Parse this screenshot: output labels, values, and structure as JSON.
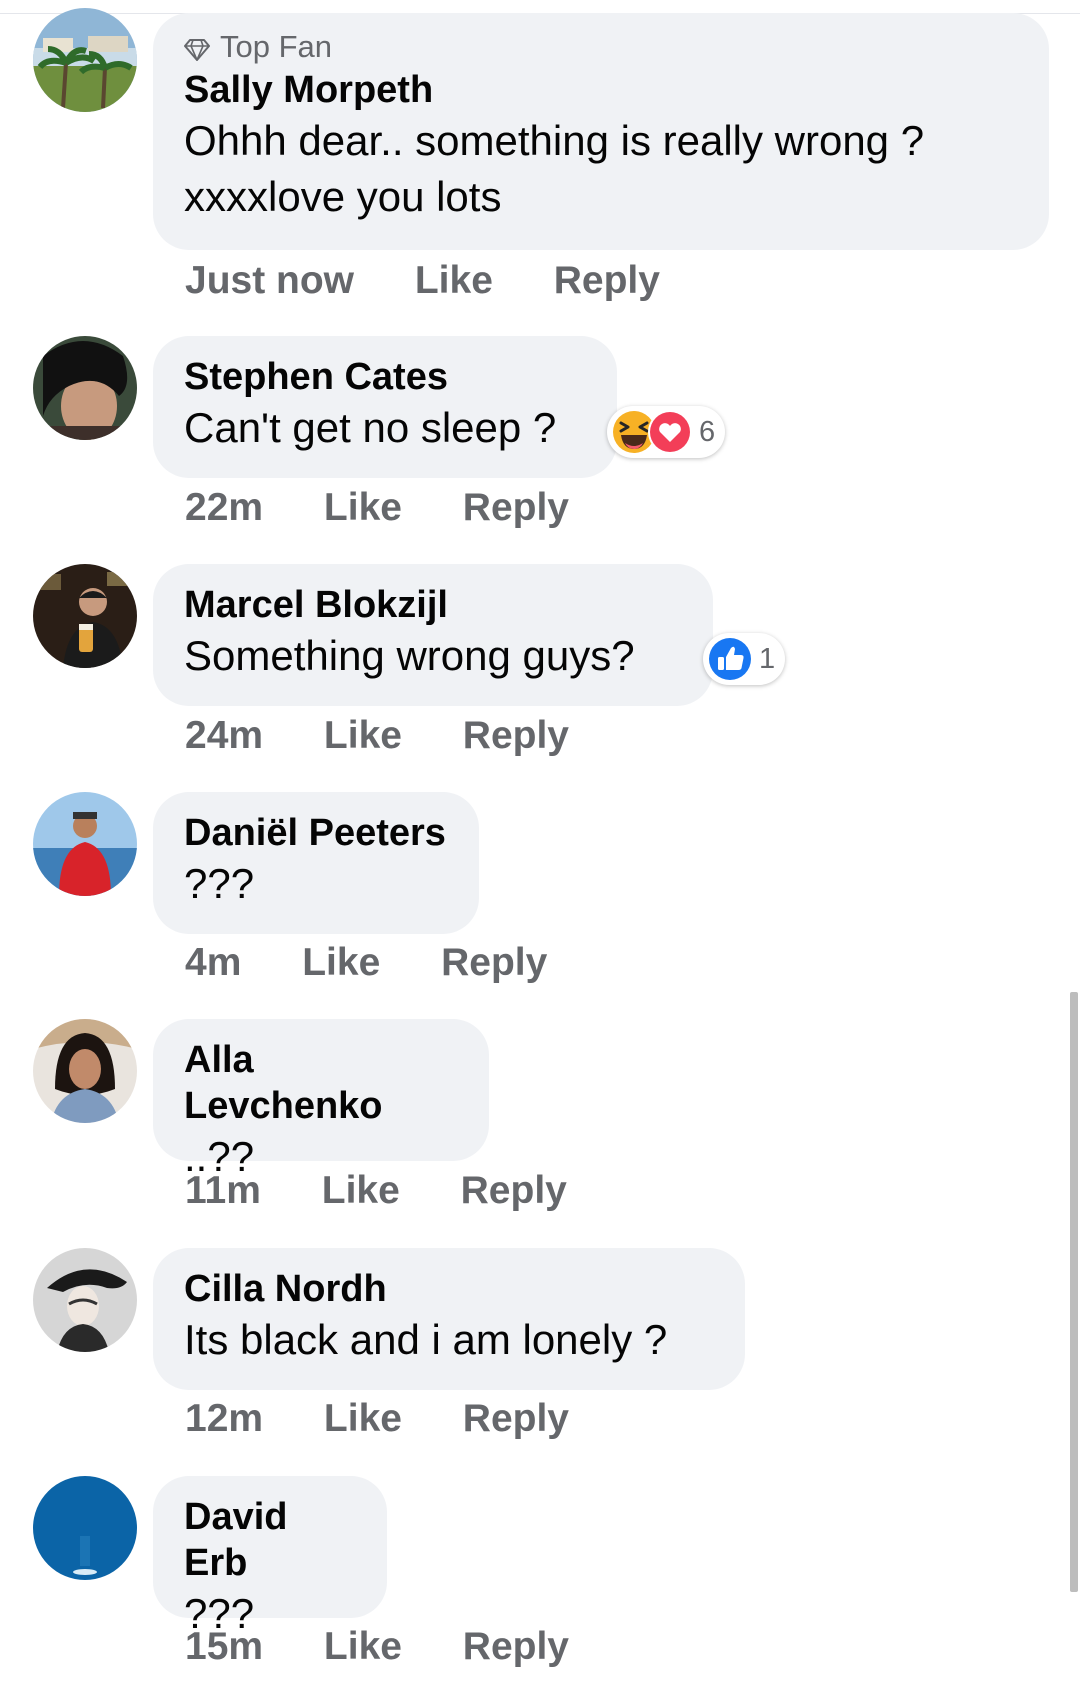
{
  "comments": [
    {
      "badge": "Top Fan",
      "author": "Sally Morpeth",
      "lines": [
        "Ohhh dear.. something is really wrong ?",
        "xxxxlove you lots"
      ],
      "time": "Just now",
      "like": "Like",
      "reply": "Reply"
    },
    {
      "author": "Stephen Cates",
      "lines": [
        "Can't get no sleep ?"
      ],
      "time": "22m",
      "like": "Like",
      "reply": "Reply",
      "reactions": {
        "icons": [
          "haha",
          "love"
        ],
        "count": "6"
      }
    },
    {
      "author": "Marcel Blokzijl",
      "lines": [
        "Something wrong guys?"
      ],
      "time": "24m",
      "like": "Like",
      "reply": "Reply",
      "reactions": {
        "icons": [
          "like"
        ],
        "count": "1"
      }
    },
    {
      "author": "Daniël Peeters",
      "lines": [
        "???"
      ],
      "time": "4m",
      "like": "Like",
      "reply": "Reply"
    },
    {
      "author": "Alla Levchenko",
      "lines": [
        "..??"
      ],
      "time": "11m",
      "like": "Like",
      "reply": "Reply"
    },
    {
      "author": "Cilla Nordh",
      "lines": [
        "Its black and i am lonely ?"
      ],
      "time": "12m",
      "like": "Like",
      "reply": "Reply"
    },
    {
      "author": "David Erb",
      "lines": [
        "???"
      ],
      "time": "15m",
      "like": "Like",
      "reply": "Reply"
    }
  ],
  "colors": {
    "bubble": "#f0f2f5",
    "meta_text": "#65676b",
    "like_blue": "#1877f2",
    "love_red": "#f33e58",
    "haha_yellow": "#f7b125"
  }
}
